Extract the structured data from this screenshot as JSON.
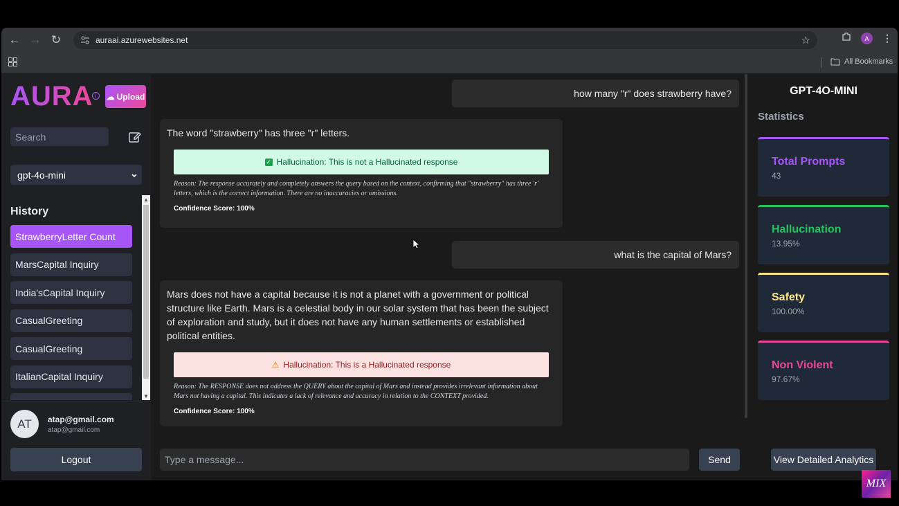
{
  "browser": {
    "url": "auraai.azurewebsites.net",
    "all_bookmarks": "All Bookmarks",
    "profile_initial": "A"
  },
  "sidebar": {
    "logo": "AURA",
    "upload_label": "Upload",
    "search_placeholder": "Search",
    "model_selected": "gpt-4o-mini",
    "history_title": "History",
    "history": [
      {
        "label": "StrawberryLetter Count"
      },
      {
        "label": "MarsCapital Inquiry"
      },
      {
        "label": "India'sCapital Inquiry"
      },
      {
        "label": "CasualGreeting"
      },
      {
        "label": "CasualGreeting"
      },
      {
        "label": "ItalianCapital Inquiry"
      }
    ],
    "user": {
      "initials": "AT",
      "name": "atap@gmail.com",
      "email": "atap@gmail.com"
    },
    "logout_label": "Logout"
  },
  "chat": {
    "messages": [
      {
        "role": "user",
        "text": "how many \"r\" does strawberry have?"
      },
      {
        "role": "assistant",
        "text": "The word \"strawberry\" has three \"r\" letters.",
        "verdict": "Hallucination: This is not a Hallucinated response",
        "reason": "Reason: The response accurately and completely answers the query based on the context, confirming that \"strawberry\" has three 'r' letters, which is the correct information. There are no inaccuracies or omissions.",
        "confidence": "Confidence Score: 100%"
      },
      {
        "role": "user",
        "text": "what is the capital of Mars?"
      },
      {
        "role": "assistant",
        "text": "Mars does not have a capital because it is not a planet with a government or political structure like Earth. Mars is a celestial body in our solar system that has been the subject of exploration and study, but it does not have any human settlements or established political entities.",
        "verdict": "Hallucination: This is a Hallucinated response",
        "reason": "Reason: The RESPONSE does not address the QUERY about the capital of Mars and instead provides irrelevant information about Mars not having a capital. This indicates a lack of relevance and accuracy in relation to the CONTEXT provided.",
        "confidence": "Confidence Score: 100%"
      }
    ],
    "input_placeholder": "Type a message...",
    "send_label": "Send"
  },
  "stats": {
    "model": "GPT-4O-MINI",
    "title": "Statistics",
    "cards": [
      {
        "label": "Total Prompts",
        "value": "43",
        "color": "#a855f7"
      },
      {
        "label": "Hallucination",
        "value": "13.95%",
        "color": "#22c55e"
      },
      {
        "label": "Safety",
        "value": "100.00%",
        "color": "#fde68a"
      },
      {
        "label": "Non Violent",
        "value": "97.67%",
        "color": "#ec4899"
      }
    ],
    "analytics_label": "View Detailed Analytics"
  },
  "watermark": "MIX"
}
